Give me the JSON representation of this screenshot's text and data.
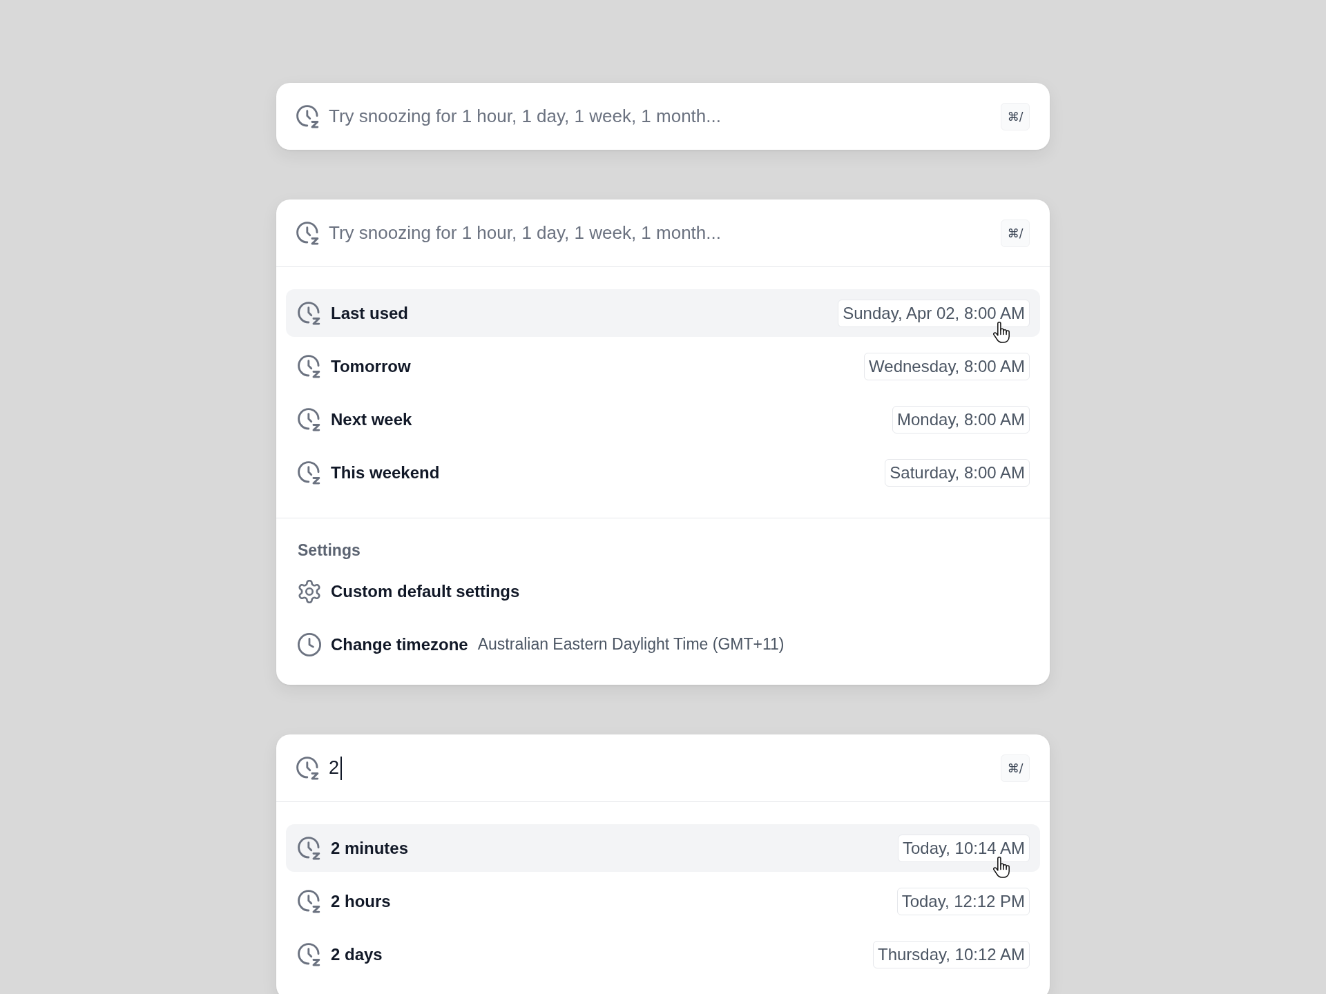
{
  "cards": [
    {
      "search": {
        "placeholder": "Try snoozing for 1 hour, 1 day, 1 week, 1 month..."
      },
      "shortcut": "⌘/"
    },
    {
      "search": {
        "placeholder": "Try snoozing for 1 hour, 1 day, 1 week, 1 month..."
      },
      "shortcut": "⌘/",
      "sections": [
        {
          "items": [
            {
              "kind": "snooze",
              "label": "Last used",
              "time": "Sunday, Apr 02, 8:00 AM",
              "selected": true
            },
            {
              "kind": "snooze",
              "label": "Tomorrow",
              "time": "Wednesday, 8:00 AM",
              "selected": false
            },
            {
              "kind": "snooze",
              "label": "Next week",
              "time": "Monday, 8:00 AM",
              "selected": false
            },
            {
              "kind": "snooze",
              "label": "This weekend",
              "time": "Saturday, 8:00 AM",
              "selected": false
            }
          ]
        },
        {
          "heading": "Settings",
          "items": [
            {
              "kind": "settings",
              "label": "Custom default settings",
              "selected": false
            },
            {
              "kind": "timezone",
              "label": "Change timezone",
              "detail": "Australian Eastern Daylight Time (GMT+11)",
              "selected": false
            }
          ]
        }
      ]
    },
    {
      "search": {
        "value": "2"
      },
      "shortcut": "⌘/",
      "sections": [
        {
          "items": [
            {
              "kind": "snooze",
              "label": "2 minutes",
              "time": "Today, 10:14 AM",
              "selected": true
            },
            {
              "kind": "snooze",
              "label": "2 hours",
              "time": "Today, 12:12 PM",
              "selected": false
            },
            {
              "kind": "snooze",
              "label": "2 days",
              "time": "Thursday, 10:12 AM",
              "selected": false
            }
          ]
        }
      ]
    }
  ]
}
